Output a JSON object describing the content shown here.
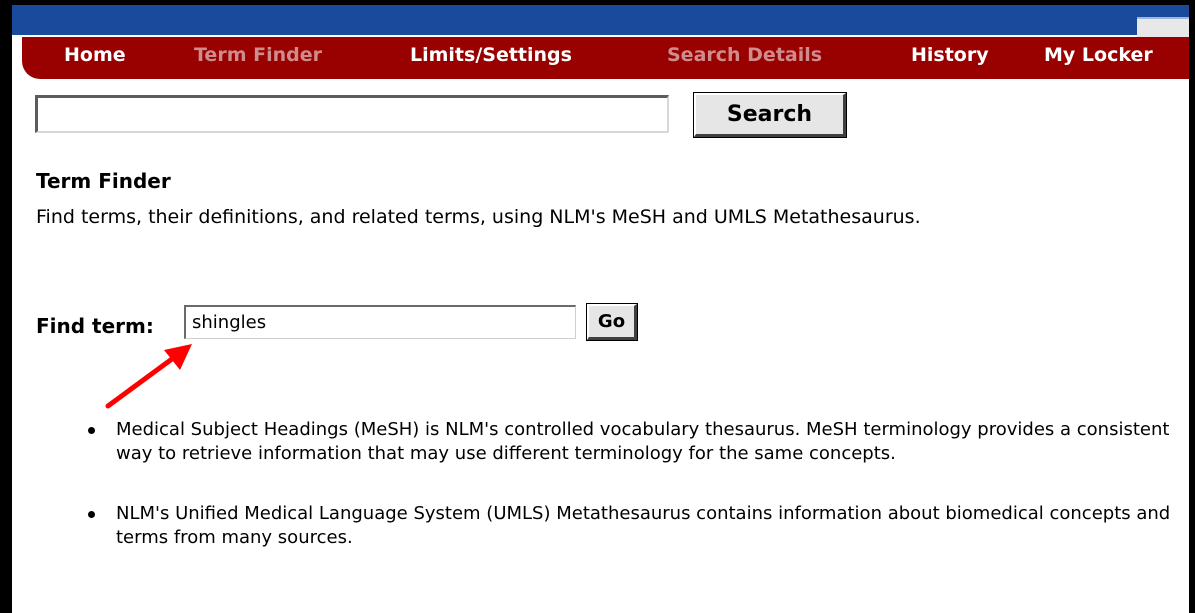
{
  "nav": {
    "items": [
      {
        "label": "Home",
        "state": "active"
      },
      {
        "label": "Term Finder",
        "state": "current"
      },
      {
        "label": "Limits/Settings",
        "state": "active"
      },
      {
        "label": "Search Details",
        "state": "current"
      },
      {
        "label": "History",
        "state": "active"
      },
      {
        "label": "My Locker",
        "state": "active"
      }
    ]
  },
  "search": {
    "value": "",
    "button_label": "Search"
  },
  "term_finder": {
    "heading": "Term Finder",
    "description": "Find terms, their definitions, and related terms, using NLM's MeSH and UMLS Metathesaurus.",
    "find_label": "Find term:",
    "find_value": "shingles",
    "go_label": "Go"
  },
  "info": {
    "bullets": [
      "Medical Subject Headings (MeSH) is NLM's controlled vocabulary thesaurus. MeSH terminology provides a consistent way to retrieve information that may use different terminology for the same concepts.",
      "NLM's Unified Medical Language System (UMLS) Metathesaurus contains information about biomedical concepts and terms from many sources."
    ]
  },
  "colors": {
    "nav_bg": "#990000",
    "nav_text": "#ffffff",
    "nav_text_dim": "#cf8c8c",
    "header_strip": "#1a4a9c",
    "annotation_arrow": "#ff0000"
  }
}
